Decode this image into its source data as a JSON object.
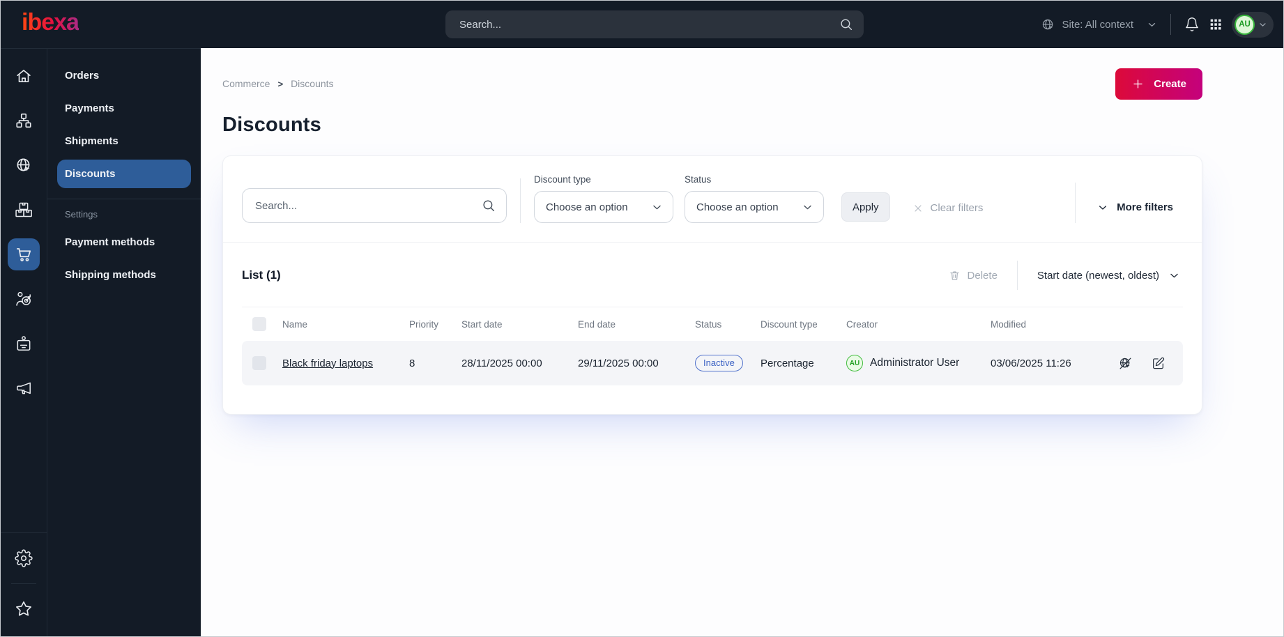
{
  "colors": {
    "topbar_bg": "#131b26",
    "accent_blue": "#2e5d99",
    "brand_start": "#ff4713",
    "brand_end": "#a92c86",
    "create_start": "#dc0a3a",
    "create_end": "#c4017c",
    "status_inactive": "#3d63c4",
    "avatar_green": "#23a023",
    "row_bg": "#f4f5f8"
  },
  "topbar": {
    "logo_text": "ibexa",
    "search_placeholder": "Search...",
    "site_context_label": "Site: All context",
    "avatar_initials": "AU",
    "icons": [
      "search-icon",
      "globe-icon",
      "chevron-down-icon",
      "bell-icon",
      "apps-grid-icon"
    ]
  },
  "rail": {
    "icons": [
      "home-icon",
      "site-structure-icon",
      "site-globe-icon",
      "products-icon",
      "commerce-cart-icon",
      "audience-target-icon",
      "customer-badge-icon",
      "campaign-megaphone-icon",
      "settings-gear-icon",
      "bookmarks-star-icon"
    ],
    "active_icon": "commerce-cart-icon"
  },
  "sidebar": {
    "items": [
      {
        "label": "Orders"
      },
      {
        "label": "Payments"
      },
      {
        "label": "Shipments"
      },
      {
        "label": "Discounts"
      }
    ],
    "active_item": "Discounts",
    "settings_heading": "Settings",
    "settings_items": [
      {
        "label": "Payment methods"
      },
      {
        "label": "Shipping methods"
      }
    ]
  },
  "page": {
    "breadcrumb": {
      "items": [
        "Commerce",
        "Discounts"
      ],
      "separator": ">"
    },
    "create_button": "Create",
    "title": "Discounts",
    "filters": {
      "search_placeholder": "Search...",
      "discount_type": {
        "label": "Discount type",
        "value": "Choose an option"
      },
      "status": {
        "label": "Status",
        "value": "Choose an option"
      },
      "apply": "Apply",
      "clear": "Clear filters",
      "more": "More filters"
    },
    "list": {
      "title": "List (1)",
      "delete": "Delete",
      "sort": "Start date (newest, oldest)",
      "columns": [
        "Name",
        "Priority",
        "Start date",
        "End date",
        "Status",
        "Discount type",
        "Creator",
        "Modified"
      ],
      "rows": [
        {
          "name": "Black friday laptops",
          "priority": "8",
          "start_date": "28/11/2025 00:00",
          "end_date": "29/11/2025 00:00",
          "status": "Inactive",
          "discount_type": "Percentage",
          "creator_initials": "AU",
          "creator_name": "Administrator User",
          "modified": "03/06/2025 11:26"
        }
      ]
    }
  }
}
